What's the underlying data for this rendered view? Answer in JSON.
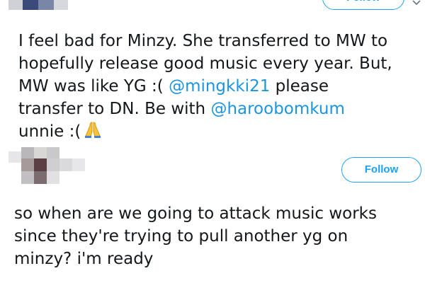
{
  "tweets": [
    {
      "follow_label": "Follow",
      "lines": [
        {
          "text": "I feel bad for Minzy. She transferred to MW to"
        },
        {
          "text": "hopefully release good music every year. But,"
        },
        {
          "before": "MW was like YG :( ",
          "mention": "@mingkki21",
          "after": " please"
        },
        {
          "before": "transfer to DN. Be with ",
          "mention": "@haroobomkum"
        },
        {
          "text": "unnie :(",
          "emoji": "folded-hands-emoji"
        }
      ]
    },
    {
      "follow_label": "Follow",
      "lines": [
        {
          "text": "so when are we going to attack music works"
        },
        {
          "text": "since they're trying to pull another yg on"
        },
        {
          "text": "minzy? i'm ready"
        }
      ]
    }
  ],
  "colors": {
    "accent": "#1da1f2",
    "mention": "#1b95e0",
    "text": "#14171a"
  }
}
